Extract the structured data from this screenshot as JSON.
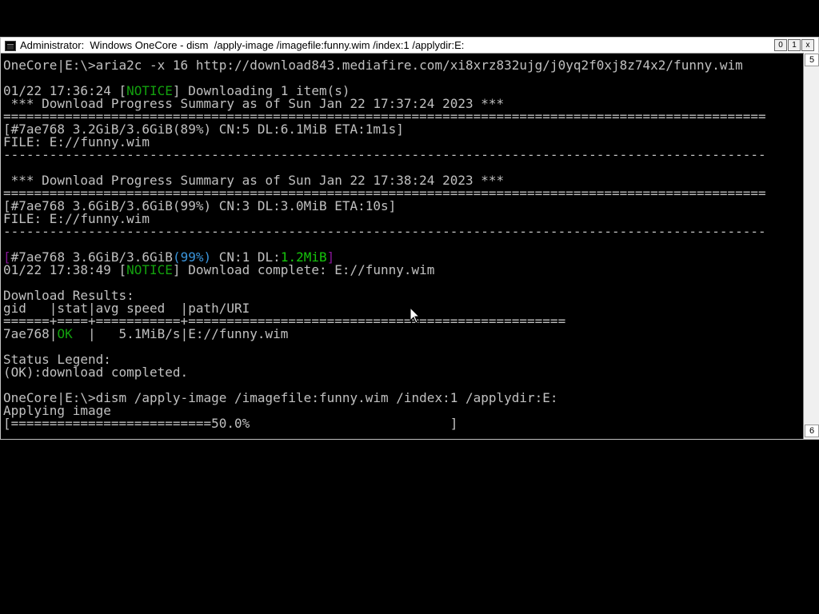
{
  "window": {
    "title": "Administrator:  Windows OneCore - dism  /apply-image /imagefile:funny.wim /index:1 /applydir:E:",
    "buttons": {
      "minimize": "0",
      "maximize": "1",
      "close": "x"
    }
  },
  "scrollbar": {
    "up_label": "5",
    "down_label": "6"
  },
  "console": {
    "lines": [
      {
        "segments": [
          {
            "text": "OneCore|E:\\>aria2c -x 16 http://download843.mediafire.com/xi8xrz832ujg/j0yq2f0xj8z74x2/funny.wim",
            "color": ""
          }
        ]
      },
      {
        "segments": [
          {
            "text": "",
            "color": ""
          }
        ]
      },
      {
        "segments": [
          {
            "text": "01/22 17:36:24 [",
            "color": ""
          },
          {
            "text": "NOTICE",
            "color": "green"
          },
          {
            "text": "] Downloading 1 item(s)",
            "color": ""
          }
        ]
      },
      {
        "segments": [
          {
            "text": " *** Download Progress Summary as of Sun Jan 22 17:37:24 2023 ***",
            "color": ""
          }
        ]
      },
      {
        "segments": [
          {
            "text": "===================================================================================================",
            "color": ""
          }
        ]
      },
      {
        "segments": [
          {
            "text": "[#7ae768 3.2GiB/3.6GiB(89%) CN:5 DL:6.1MiB ETA:1m1s]",
            "color": ""
          }
        ]
      },
      {
        "segments": [
          {
            "text": "FILE: E://funny.wim",
            "color": ""
          }
        ]
      },
      {
        "segments": [
          {
            "text": "---------------------------------------------------------------------------------------------------",
            "color": ""
          }
        ]
      },
      {
        "segments": [
          {
            "text": "",
            "color": ""
          }
        ]
      },
      {
        "segments": [
          {
            "text": " *** Download Progress Summary as of Sun Jan 22 17:38:24 2023 ***",
            "color": ""
          }
        ]
      },
      {
        "segments": [
          {
            "text": "===================================================================================================",
            "color": ""
          }
        ]
      },
      {
        "segments": [
          {
            "text": "[#7ae768 3.6GiB/3.6GiB(99%) CN:3 DL:3.0MiB ETA:10s]",
            "color": ""
          }
        ]
      },
      {
        "segments": [
          {
            "text": "FILE: E://funny.wim",
            "color": ""
          }
        ]
      },
      {
        "segments": [
          {
            "text": "---------------------------------------------------------------------------------------------------",
            "color": ""
          }
        ]
      },
      {
        "segments": [
          {
            "text": "",
            "color": ""
          }
        ]
      },
      {
        "segments": [
          {
            "text": "[",
            "color": "magenta"
          },
          {
            "text": "#7ae768 3.6GiB/3.6GiB",
            "color": ""
          },
          {
            "text": "(99%)",
            "color": "cyan"
          },
          {
            "text": " CN:1 DL:",
            "color": ""
          },
          {
            "text": "1.2MiB",
            "color": "lime"
          },
          {
            "text": "]",
            "color": "magenta"
          }
        ]
      },
      {
        "segments": [
          {
            "text": "01/22 17:38:49 [",
            "color": ""
          },
          {
            "text": "NOTICE",
            "color": "green"
          },
          {
            "text": "] Download complete: E://funny.wim",
            "color": ""
          }
        ]
      },
      {
        "segments": [
          {
            "text": "",
            "color": ""
          }
        ]
      },
      {
        "segments": [
          {
            "text": "Download Results:",
            "color": ""
          }
        ]
      },
      {
        "segments": [
          {
            "text": "gid   |stat|avg speed  |path/URI",
            "color": ""
          }
        ]
      },
      {
        "segments": [
          {
            "text": "======+====+===========+=================================================",
            "color": ""
          }
        ]
      },
      {
        "segments": [
          {
            "text": "7ae768|",
            "color": ""
          },
          {
            "text": "OK",
            "color": "green"
          },
          {
            "text": "  |   5.1MiB/s|E://funny.wim",
            "color": ""
          }
        ]
      },
      {
        "segments": [
          {
            "text": "",
            "color": ""
          }
        ]
      },
      {
        "segments": [
          {
            "text": "Status Legend:",
            "color": ""
          }
        ]
      },
      {
        "segments": [
          {
            "text": "(OK):download completed.",
            "color": ""
          }
        ]
      },
      {
        "segments": [
          {
            "text": "",
            "color": ""
          }
        ]
      },
      {
        "segments": [
          {
            "text": "OneCore|E:\\>dism /apply-image /imagefile:funny.wim /index:1 /applydir:E:",
            "color": ""
          }
        ]
      },
      {
        "segments": [
          {
            "text": "Applying image",
            "color": ""
          }
        ]
      },
      {
        "segments": [
          {
            "text": "[==========================50.0%                          ]",
            "color": ""
          }
        ]
      }
    ]
  }
}
